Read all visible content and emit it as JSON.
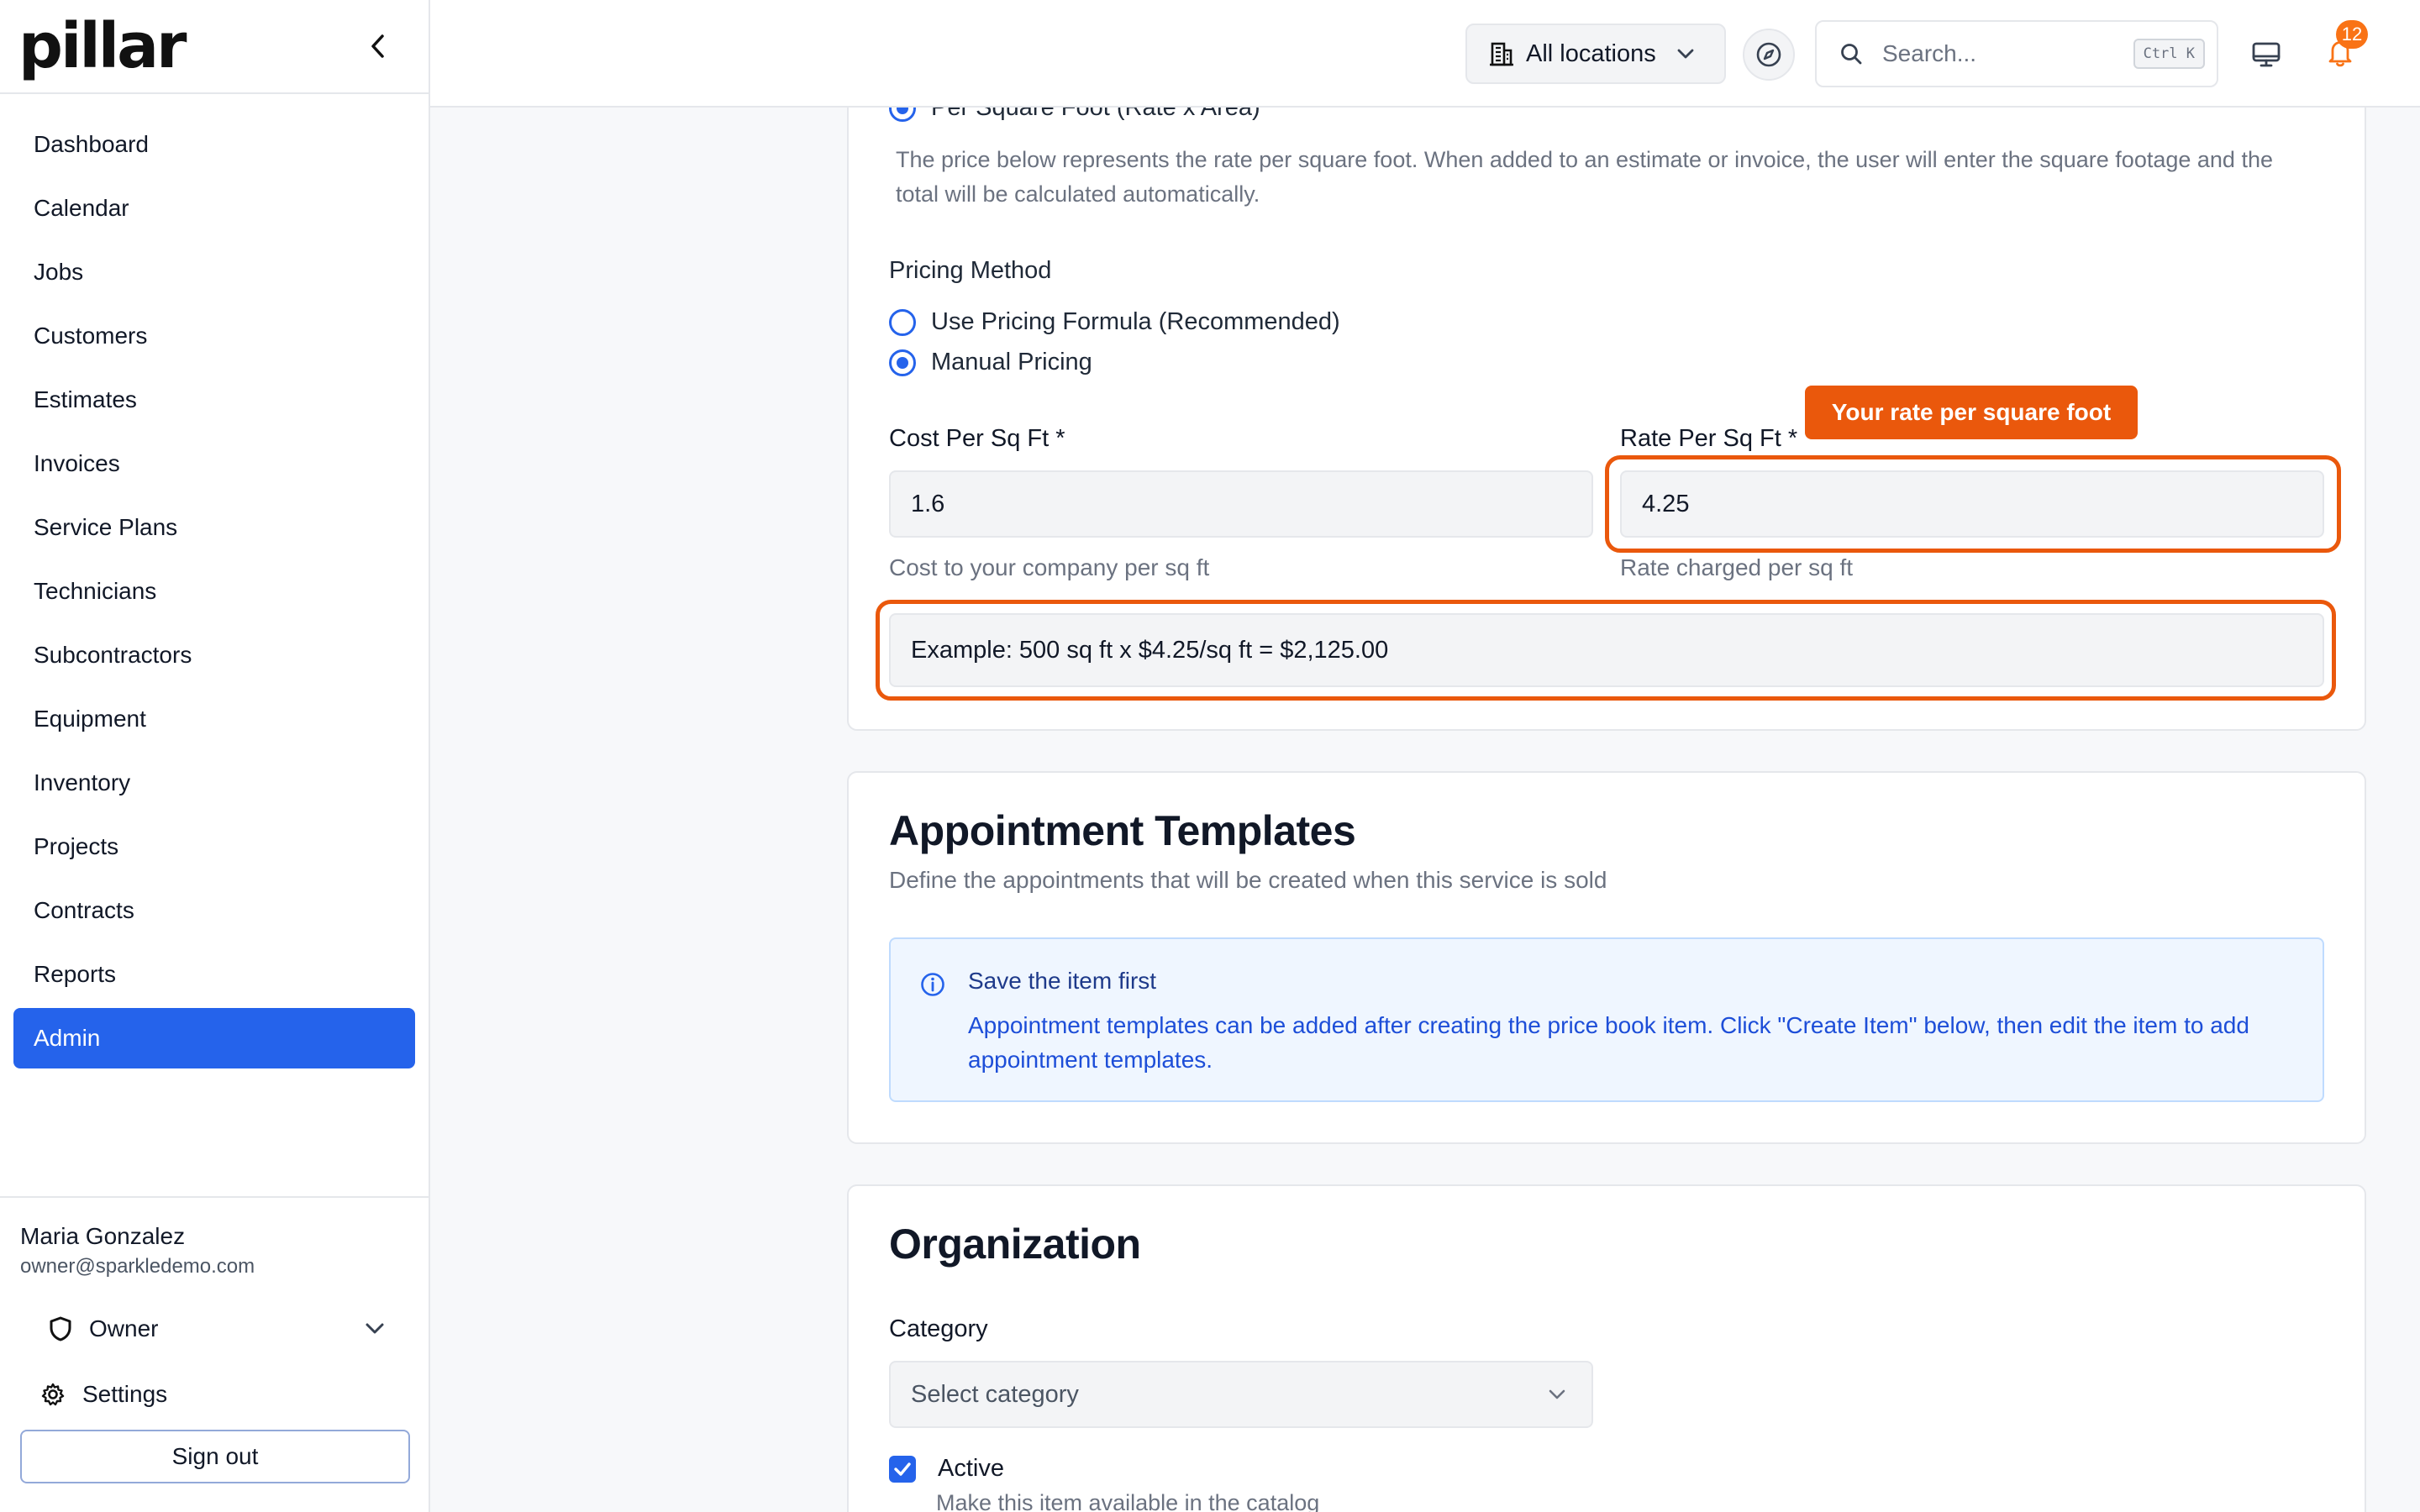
{
  "sidebar": {
    "logo": "pillar",
    "items": [
      {
        "label": "Dashboard"
      },
      {
        "label": "Calendar"
      },
      {
        "label": "Jobs"
      },
      {
        "label": "Customers"
      },
      {
        "label": "Estimates"
      },
      {
        "label": "Invoices"
      },
      {
        "label": "Service Plans"
      },
      {
        "label": "Technicians"
      },
      {
        "label": "Subcontractors"
      },
      {
        "label": "Equipment"
      },
      {
        "label": "Inventory"
      },
      {
        "label": "Projects"
      },
      {
        "label": "Contracts"
      },
      {
        "label": "Reports"
      },
      {
        "label": "Admin",
        "active": true
      }
    ],
    "user": {
      "name": "Maria Gonzalez",
      "email": "owner@sparkledemo.com",
      "role": "Owner"
    },
    "settings_label": "Settings",
    "signout_label": "Sign out"
  },
  "topbar": {
    "location_label": "All locations",
    "search_placeholder": "Search...",
    "search_shortcut": "Ctrl K",
    "notification_count": "12"
  },
  "pricing": {
    "radio_per_sqft_label": "Per Square Foot (Rate x Area)",
    "description": "The price below represents the rate per square foot. When added to an estimate or invoice, the user will enter the square footage and the total will be calculated automatically.",
    "method_label": "Pricing Method",
    "method_options": [
      {
        "label": "Use Pricing Formula (Recommended)",
        "selected": false
      },
      {
        "label": "Manual Pricing",
        "selected": true
      }
    ],
    "cost_label": "Cost Per Sq Ft *",
    "cost_value": "1.6",
    "cost_help": "Cost to your company per sq ft",
    "rate_label": "Rate Per Sq Ft *",
    "rate_value": "4.25",
    "rate_help": "Rate charged per sq ft",
    "tooltip": "Your rate per square foot",
    "example_prefix": "Example:",
    "example_text": "500 sq ft x $4.25/sq ft = $2,125.00"
  },
  "appointments": {
    "title": "Appointment Templates",
    "subtitle": "Define the appointments that will be created when this service is sold",
    "info_title": "Save the item first",
    "info_text": "Appointment templates can be added after creating the price book item. Click \"Create Item\" below, then edit the item to add appointment templates."
  },
  "organization": {
    "title": "Organization",
    "category_label": "Category",
    "category_placeholder": "Select category",
    "active_label": "Active",
    "active_checked": true,
    "active_help": "Make this item available in the catalog"
  },
  "colors": {
    "accent": "#2563eb",
    "highlight": "#ea580c",
    "badge": "#f97316"
  }
}
